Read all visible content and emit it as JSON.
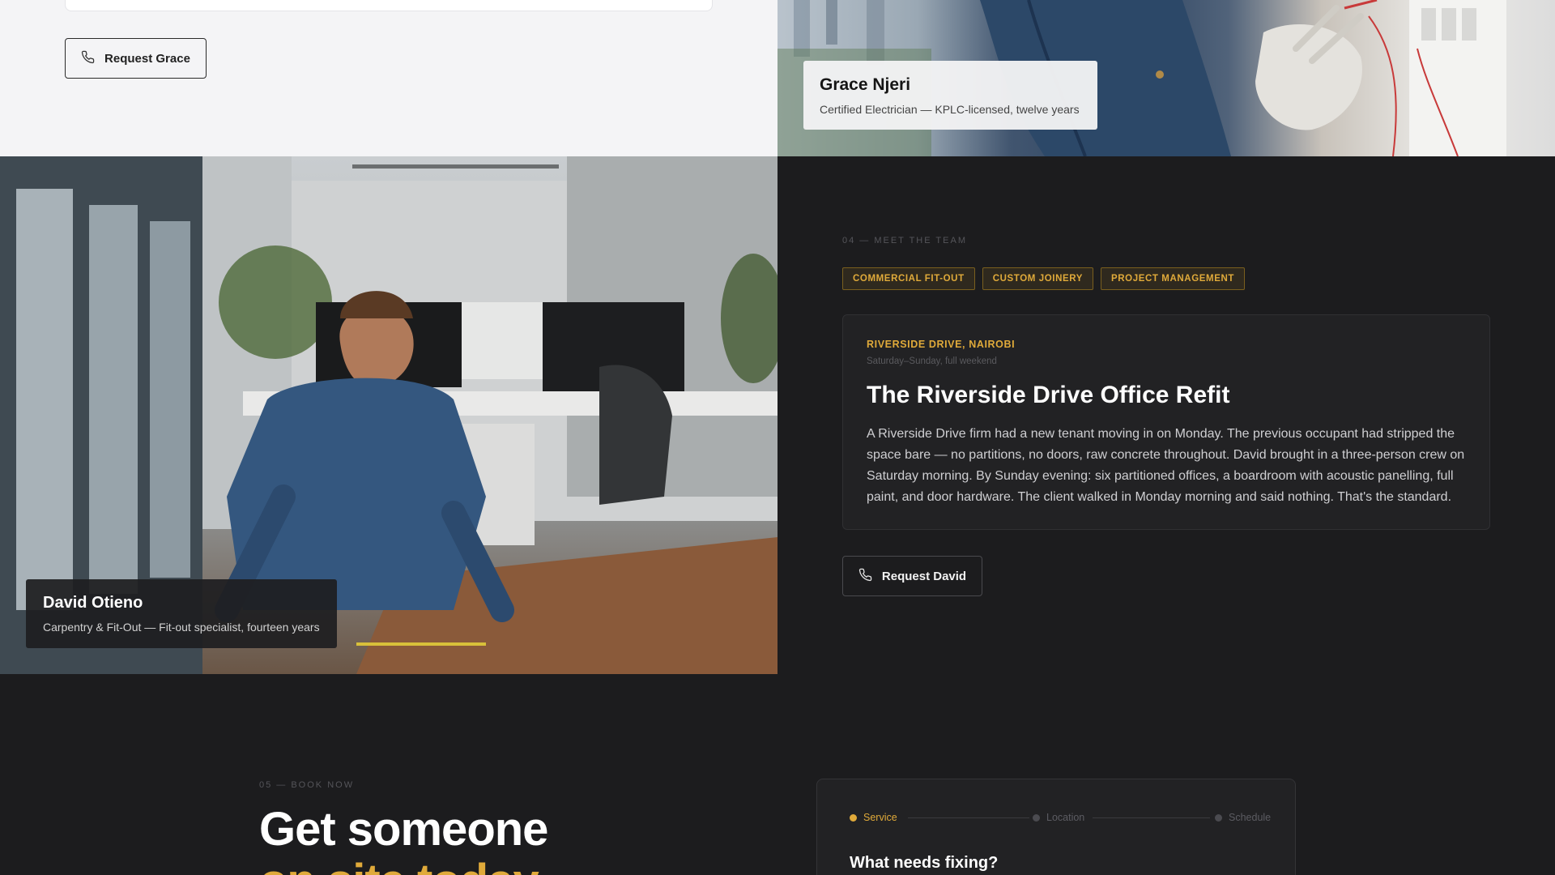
{
  "grace": {
    "request_button": "Request Grace",
    "name": "Grace Njeri",
    "role": "Certified Electrician — KPLC-licensed, twelve years"
  },
  "david": {
    "name": "David Otieno",
    "role": "Carpentry & Fit-Out — Fit-out specialist, fourteen years",
    "request_button": "Request David"
  },
  "team_section": {
    "eyebrow": "04 — MEET THE TEAM",
    "tags": [
      "COMMERCIAL FIT-OUT",
      "CUSTOM JOINERY",
      "PROJECT MANAGEMENT"
    ],
    "story": {
      "location": "RIVERSIDE DRIVE, NAIROBI",
      "when": "Saturday–Sunday, full weekend",
      "title": "The Riverside Drive Office Refit",
      "body": "A Riverside Drive firm had a new tenant moving in on Monday. The previous occupant had stripped the space bare — no partitions, no doors, raw concrete throughout. David brought in a three-person crew on Saturday morning. By Sunday evening: six partitioned offices, a boardroom with acoustic panelling, full paint, and door hardware. The client walked in Monday morning and said nothing. That's the standard."
    }
  },
  "book_section": {
    "eyebrow": "05 — BOOK NOW",
    "headline_line1": "Get someone",
    "headline_line2": "on site today",
    "steps": [
      "Service",
      "Location",
      "Schedule"
    ],
    "active_step": "Service",
    "question": "What needs fixing?"
  },
  "colors": {
    "accent": "#e0aa3a",
    "dark_bg": "#1c1c1e",
    "light_bg": "#f4f4f6"
  },
  "icons": {
    "request_button_icon": "phone-icon"
  }
}
